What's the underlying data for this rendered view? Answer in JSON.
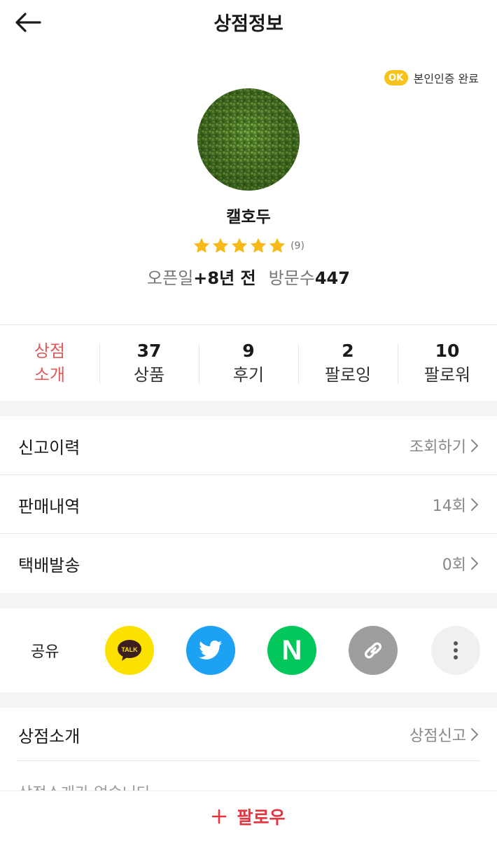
{
  "header": {
    "title": "상점정보",
    "back_icon": "arrow-left-icon"
  },
  "verification": {
    "badge": "OK",
    "text": "본인인증 완료",
    "badge_color": "#f7c31b"
  },
  "profile": {
    "name": "캘호두",
    "rating_stars": 5,
    "rating_count": "(9)",
    "open_label": "오픈일",
    "open_value": "+8년 전",
    "visits_label": "방문수",
    "visits_value": "447"
  },
  "stats": {
    "intro": {
      "line1": "상점",
      "line2": "소개"
    },
    "items": [
      {
        "num": "37",
        "label": "상품"
      },
      {
        "num": "9",
        "label": "후기"
      },
      {
        "num": "2",
        "label": "팔로잉"
      },
      {
        "num": "10",
        "label": "팔로워"
      }
    ]
  },
  "info_rows": [
    {
      "label": "신고이력",
      "value": "조회하기"
    },
    {
      "label": "판매내역",
      "value": "14회"
    },
    {
      "label": "택배발송",
      "value": "0회"
    }
  ],
  "share": {
    "label": "공유",
    "buttons": [
      {
        "name": "kakaotalk",
        "text": "TALK",
        "color": "#fae100"
      },
      {
        "name": "twitter",
        "color": "#1da1f2"
      },
      {
        "name": "naver",
        "text": "N",
        "color": "#03c75a"
      },
      {
        "name": "link",
        "color": "#9e9e9e"
      },
      {
        "name": "more",
        "color": "#f0f0f0"
      }
    ]
  },
  "intro_section": {
    "label": "상점소개",
    "action": "상점신고",
    "text": "상점소개가 없습니다"
  },
  "follow": {
    "label": "팔로우",
    "accent_color": "#e3343f"
  },
  "colors": {
    "accent": "#e05a5a",
    "star": "#f7b917"
  }
}
